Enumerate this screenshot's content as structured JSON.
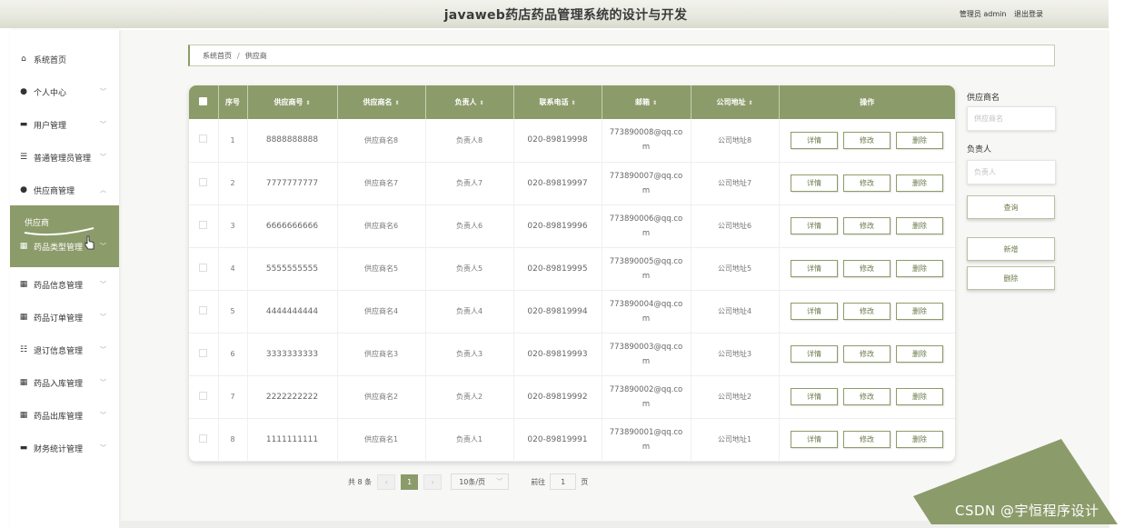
{
  "header": {
    "title": "javaweb药店药品管理系统的设计与开发",
    "user_label": "管理员 admin",
    "logout_label": "退出登录"
  },
  "sidebar": {
    "items": [
      {
        "label": "系统首页",
        "icon": "home-icon"
      },
      {
        "label": "个人中心",
        "icon": "person-icon"
      },
      {
        "label": "用户管理",
        "icon": "chat-icon"
      },
      {
        "label": "普通管理员管理",
        "icon": "list-icon"
      },
      {
        "label": "供应商管理",
        "icon": "person-icon"
      },
      {
        "label": "药品类型管理",
        "icon": "grid-icon"
      },
      {
        "label": "药品信息管理",
        "icon": "grid-icon"
      },
      {
        "label": "药品订单管理",
        "icon": "grid-icon"
      },
      {
        "label": "退订信息管理",
        "icon": "sliders-icon"
      },
      {
        "label": "药品入库管理",
        "icon": "grid-icon"
      },
      {
        "label": "药品出库管理",
        "icon": "grid-icon"
      },
      {
        "label": "财务统计管理",
        "icon": "briefcase-icon"
      }
    ],
    "sub_item": "供应商"
  },
  "breadcrumb": {
    "home": "系统首页",
    "sep": "/",
    "current": "供应商"
  },
  "table": {
    "headers": [
      "序号",
      "供应商号",
      "供应商名",
      "负责人",
      "联系电话",
      "邮箱",
      "公司地址",
      "操作"
    ],
    "rows": [
      {
        "no": "1",
        "code": "8888888888",
        "name": "供应商名8",
        "contact": "负责人8",
        "phone": "020-89819998",
        "email": "773890008@qq.com",
        "address": "公司地址8"
      },
      {
        "no": "2",
        "code": "7777777777",
        "name": "供应商名7",
        "contact": "负责人7",
        "phone": "020-89819997",
        "email": "773890007@qq.com",
        "address": "公司地址7"
      },
      {
        "no": "3",
        "code": "6666666666",
        "name": "供应商名6",
        "contact": "负责人6",
        "phone": "020-89819996",
        "email": "773890006@qq.com",
        "address": "公司地址6"
      },
      {
        "no": "4",
        "code": "5555555555",
        "name": "供应商名5",
        "contact": "负责人5",
        "phone": "020-89819995",
        "email": "773890005@qq.com",
        "address": "公司地址5"
      },
      {
        "no": "5",
        "code": "4444444444",
        "name": "供应商名4",
        "contact": "负责人4",
        "phone": "020-89819994",
        "email": "773890004@qq.com",
        "address": "公司地址4"
      },
      {
        "no": "6",
        "code": "3333333333",
        "name": "供应商名3",
        "contact": "负责人3",
        "phone": "020-89819993",
        "email": "773890003@qq.com",
        "address": "公司地址3"
      },
      {
        "no": "7",
        "code": "2222222222",
        "name": "供应商名2",
        "contact": "负责人2",
        "phone": "020-89819992",
        "email": "773890002@qq.com",
        "address": "公司地址2"
      },
      {
        "no": "8",
        "code": "1111111111",
        "name": "供应商名1",
        "contact": "负责人1",
        "phone": "020-89819991",
        "email": "773890001@qq.com",
        "address": "公司地址1"
      }
    ],
    "actions": {
      "detail": "详情",
      "edit": "修改",
      "delete": "删除"
    }
  },
  "pagination": {
    "total_text": "共 8 条",
    "prev": "‹",
    "current_page": "1",
    "next": "›",
    "page_size": "10条/页",
    "goto_label": "前往",
    "goto_value": "1",
    "page_unit": "页"
  },
  "search": {
    "supplier_name_label": "供应商名",
    "supplier_name_placeholder": "供应商名",
    "contact_label": "负责人",
    "contact_placeholder": "负责人",
    "query_button": "查询",
    "add_button": "新增",
    "delete_button": "删除"
  },
  "watermark": "CSDN @宇恒程序设计",
  "colors": {
    "accent": "#8c9b6a"
  }
}
